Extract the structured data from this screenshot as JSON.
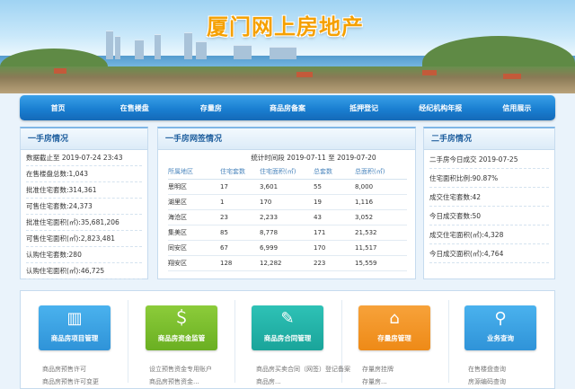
{
  "site_title": "厦门网上房地产",
  "nav": [
    "首页",
    "在售楼盘",
    "存量房",
    "商品房备案",
    "抵押登记",
    "经纪机构年报",
    "信用展示"
  ],
  "first_hand": {
    "title": "一手房情况",
    "rows": [
      "数据截止至 2019-07-24 23:43",
      "在售楼盘总数:1,043",
      "批准住宅套数:314,361",
      "可售住宅套数:24,373",
      "批准住宅面积(㎡):35,681,206",
      "可售住宅面积(㎡):2,823,481",
      "认购住宅套数:280",
      "认购住宅面积(㎡):46,725"
    ]
  },
  "online_sign": {
    "title": "一手房网签情况",
    "range_label": "统计时间段",
    "range_from": "2019-07-11",
    "range_to_label": "至",
    "range_to": "2019-07-20",
    "columns": [
      "所属地区",
      "住宅套数",
      "住宅面积(㎡)",
      "总套数",
      "总面积(㎡)"
    ],
    "rows": [
      [
        "思明区",
        "17",
        "3,601",
        "55",
        "8,000"
      ],
      [
        "湖里区",
        "1",
        "170",
        "19",
        "1,116"
      ],
      [
        "海沧区",
        "23",
        "2,233",
        "43",
        "3,052"
      ],
      [
        "集美区",
        "85",
        "8,778",
        "171",
        "21,532"
      ],
      [
        "同安区",
        "67",
        "6,999",
        "170",
        "11,517"
      ],
      [
        "翔安区",
        "128",
        "12,282",
        "223",
        "15,559"
      ]
    ]
  },
  "second_hand": {
    "title": "二手房情况",
    "rows": [
      "二手房今日成交 2019-07-25",
      "住宅面积比例:90.87%",
      "成交住宅套数:42",
      "今日成交套数:50",
      "成交住宅面积(㎡):4,328",
      "今日成交面积(㎡):4,764"
    ]
  },
  "cards": [
    {
      "label": "商品房项目管理",
      "icon": "building-icon",
      "glyph": "▥",
      "subs": [
        "商品房预售许可",
        "商品房预售许可变更"
      ]
    },
    {
      "label": "商品房资金监管",
      "icon": "money-house-icon",
      "glyph": "＄",
      "subs": [
        "设立预售资金专用账户",
        "商品房预售资金..."
      ]
    },
    {
      "label": "商品房合同管理",
      "icon": "edit-icon",
      "glyph": "✎",
      "subs": [
        "商品房买卖合同（网签）登记备案",
        "商品房..."
      ]
    },
    {
      "label": "存量房管理",
      "icon": "bank-icon",
      "glyph": "⌂",
      "subs": [
        "存量房挂牌",
        "存量房..."
      ]
    },
    {
      "label": "业务查询",
      "icon": "search-icon",
      "glyph": "⚲",
      "subs": [
        "在售楼盘查询",
        "房源编码查询"
      ]
    }
  ],
  "colors": {
    "nav": "#1a7fd1",
    "title": "#f5a000",
    "header_text": "#1f5f9e"
  }
}
